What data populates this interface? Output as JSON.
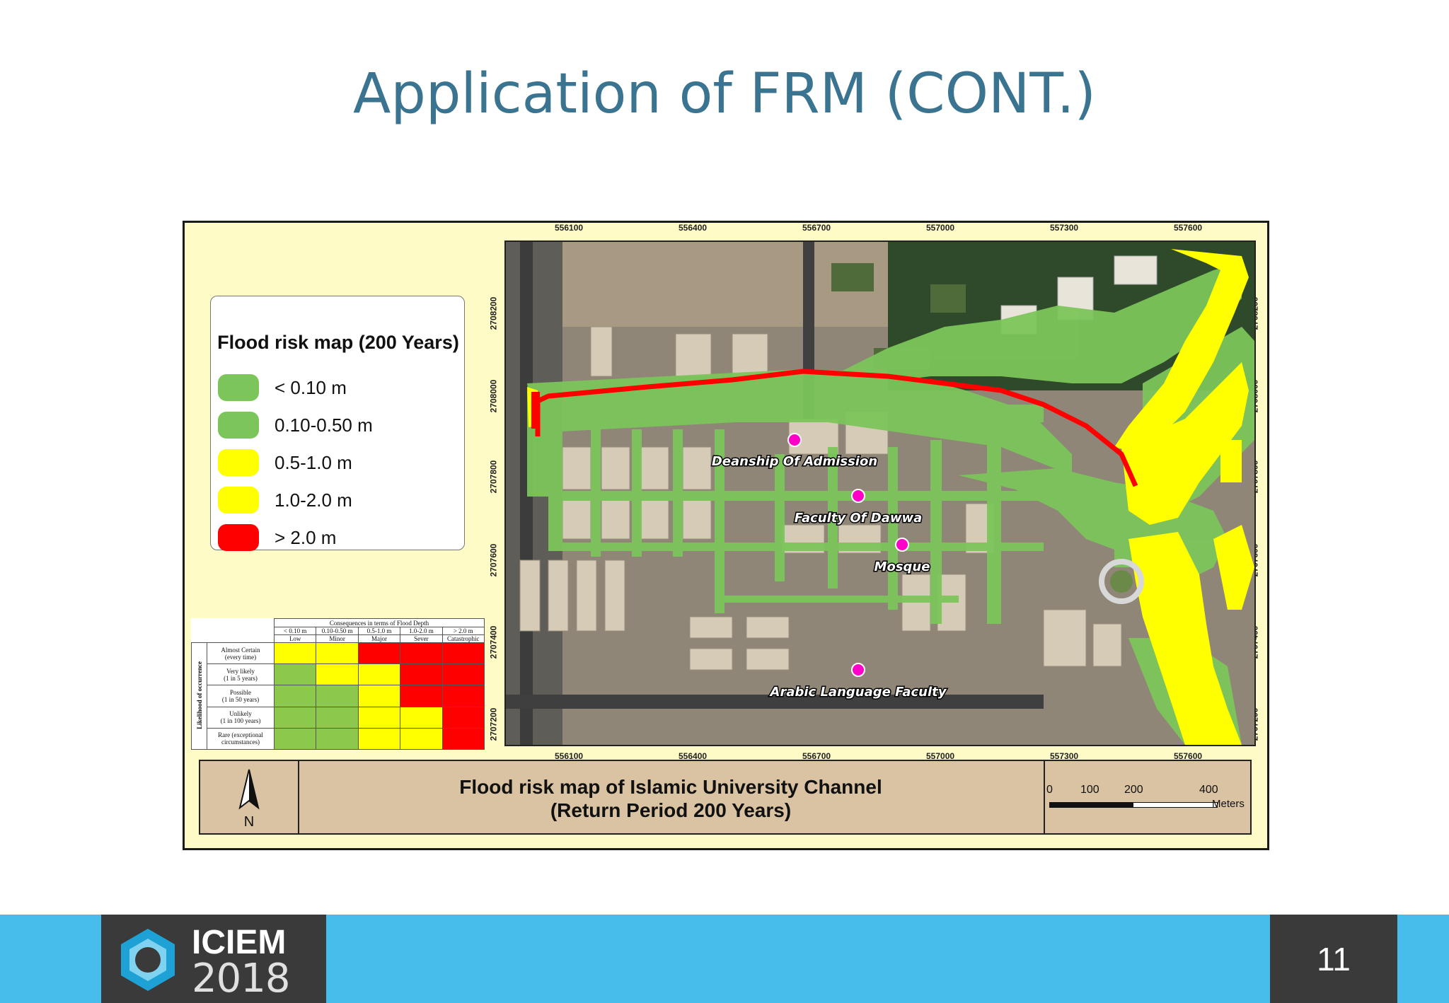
{
  "slide": {
    "title": "Application of FRM (CONT.)",
    "page_number": "11"
  },
  "legend": {
    "title": "Flood risk map (200 Years)",
    "items": [
      {
        "label": "< 0.10 m",
        "color": "#7cc55a"
      },
      {
        "label": "0.10-0.50 m",
        "color": "#7cc55a"
      },
      {
        "label": "0.5-1.0 m",
        "color": "#ffff00"
      },
      {
        "label": "1.0-2.0 m",
        "color": "#ffff00"
      },
      {
        "label": "> 2.0 m",
        "color": "#ff0000"
      }
    ]
  },
  "map": {
    "title_line1": "Flood risk map of Islamic University Channel",
    "title_line2": "(Return Period 200 Years)",
    "north_label": "N",
    "x_ticks": [
      "556100",
      "556400",
      "556700",
      "557000",
      "557300",
      "557600"
    ],
    "y_ticks": [
      "2708200",
      "2708000",
      "2707800",
      "2707600",
      "2707400",
      "2707200"
    ],
    "scale_labels": [
      "0",
      "100",
      "200",
      "400"
    ],
    "scale_unit": "Meters",
    "places": [
      {
        "label": "Deanship Of Admission"
      },
      {
        "label": "Faculty Of Dawwa"
      },
      {
        "label": "Mosque"
      },
      {
        "label": "Arabic Language Faculty"
      }
    ]
  },
  "risk_matrix": {
    "header": "Consequences in terms of Flood Depth",
    "side_label": "Likelihood of occurrence",
    "columns": [
      {
        "depth": "< 0.10 m",
        "consequence": "Low"
      },
      {
        "depth": "0.10-0.50 m",
        "consequence": "Minor"
      },
      {
        "depth": "0.5-1.0 m",
        "consequence": "Major"
      },
      {
        "depth": "1.0-2.0 m",
        "consequence": "Sever"
      },
      {
        "depth": "> 2.0 m",
        "consequence": "Catastrophic"
      }
    ],
    "rows": [
      {
        "label1": "Almost Certain",
        "label2": "(every time)",
        "cells": [
          "y",
          "y",
          "r",
          "r",
          "r"
        ]
      },
      {
        "label1": "Very likely",
        "label2": "(1 in 5 years)",
        "cells": [
          "g",
          "y",
          "y",
          "r",
          "r"
        ]
      },
      {
        "label1": "Possible",
        "label2": "(1 in 50 years)",
        "cells": [
          "g",
          "g",
          "y",
          "r",
          "r"
        ]
      },
      {
        "label1": "Unlikely",
        "label2": "(1 in 100 years)",
        "cells": [
          "g",
          "g",
          "y",
          "y",
          "r"
        ]
      },
      {
        "label1": "Rare (exceptional",
        "label2": "circumstances)",
        "cells": [
          "g",
          "g",
          "y",
          "y",
          "r"
        ]
      }
    ]
  },
  "footer": {
    "logo_line1": "ICIEM",
    "logo_line2": "2018",
    "accent_color": "#47bdeb"
  }
}
